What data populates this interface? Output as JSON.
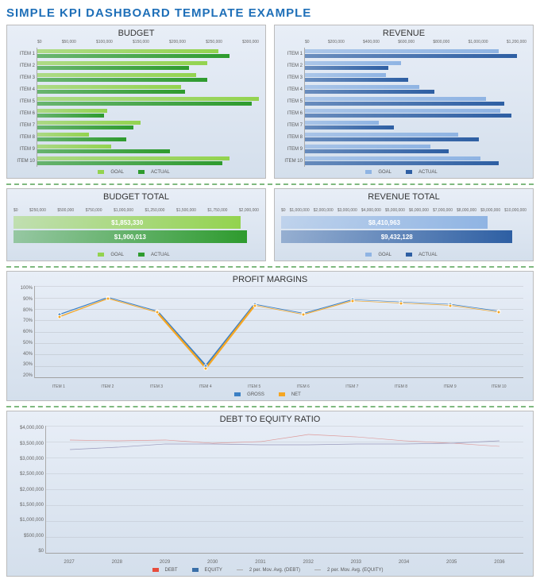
{
  "page_title": "SIMPLE KPI DASHBOARD TEMPLATE EXAMPLE",
  "legends": {
    "goal": "GOAL",
    "actual": "ACTUAL",
    "gross": "GROSS",
    "net": "NET",
    "debt": "DEBT",
    "equity": "EQUITY",
    "mov_debt": "2 per. Mov. Avg. (DEBT)",
    "mov_equity": "2 per. Mov. Avg. (EQUITY)"
  },
  "budget": {
    "title": "BUDGET",
    "ticks": [
      "$0",
      "$50,000",
      "$100,000",
      "$150,000",
      "$200,000",
      "$250,000",
      "$300,000"
    ],
    "max": 300000,
    "items": [
      "ITEM 1",
      "ITEM 2",
      "ITEM 3",
      "ITEM 4",
      "ITEM 5",
      "ITEM 6",
      "ITEM 7",
      "ITEM 8",
      "ITEM 9",
      "ITEM 10"
    ]
  },
  "revenue": {
    "title": "REVENUE",
    "ticks": [
      "$0",
      "$200,000",
      "$400,000",
      "$600,000",
      "$800,000",
      "$1,000,000",
      "$1,200,000"
    ],
    "max": 1200000,
    "items": [
      "ITEM 1",
      "ITEM 2",
      "ITEM 3",
      "ITEM 4",
      "ITEM 5",
      "ITEM 6",
      "ITEM 7",
      "ITEM 8",
      "ITEM 9",
      "ITEM 10"
    ]
  },
  "budget_total": {
    "title": "BUDGET TOTAL",
    "ticks": [
      "$0",
      "$250,000",
      "$500,000",
      "$750,000",
      "$1,000,000",
      "$1,250,000",
      "$1,500,000",
      "$1,750,000",
      "$2,000,000"
    ],
    "max": 2000000,
    "goal_label": "$1,853,330",
    "actual_label": "$1,900,013"
  },
  "revenue_total": {
    "title": "REVENUE TOTAL",
    "ticks": [
      "$0",
      "$1,000,000",
      "$2,000,000",
      "$3,000,000",
      "$4,000,000",
      "$5,000,000",
      "$6,000,000",
      "$7,000,000",
      "$8,000,000",
      "$9,000,000",
      "$10,000,000"
    ],
    "max": 10000000,
    "goal_label": "$8,410,963",
    "actual_label": "$9,432,128"
  },
  "profit": {
    "title": "PROFIT MARGINS",
    "yticks": [
      "100%",
      "90%",
      "80%",
      "70%",
      "60%",
      "50%",
      "40%",
      "30%",
      "20%"
    ],
    "items": [
      "ITEM 1",
      "ITEM 2",
      "ITEM 3",
      "ITEM 4",
      "ITEM 5",
      "ITEM 6",
      "ITEM 7",
      "ITEM 8",
      "ITEM 9",
      "ITEM 10"
    ]
  },
  "debt_equity": {
    "title": "DEBT TO EQUITY RATIO",
    "yticks": [
      "$4,000,000",
      "$3,500,000",
      "$3,000,000",
      "$2,500,000",
      "$2,000,000",
      "$1,500,000",
      "$1,000,000",
      "$500,000",
      "$0"
    ],
    "max": 4000000,
    "years": [
      "2027",
      "2028",
      "2029",
      "2030",
      "2031",
      "2032",
      "2033",
      "2034",
      "2035",
      "2036"
    ]
  },
  "chart_data": [
    {
      "type": "bar",
      "orientation": "horizontal",
      "title": "BUDGET",
      "xlabel": "",
      "ylabel": "",
      "xlim": [
        0,
        300000
      ],
      "categories": [
        "ITEM 1",
        "ITEM 2",
        "ITEM 3",
        "ITEM 4",
        "ITEM 5",
        "ITEM 6",
        "ITEM 7",
        "ITEM 8",
        "ITEM 9",
        "ITEM 10"
      ],
      "series": [
        {
          "name": "GOAL",
          "values": [
            245000,
            230000,
            215000,
            195000,
            300000,
            95000,
            140000,
            70000,
            100000,
            260000
          ]
        },
        {
          "name": "ACTUAL",
          "values": [
            260000,
            205000,
            230000,
            200000,
            290000,
            90000,
            130000,
            120000,
            180000,
            250000
          ]
        }
      ]
    },
    {
      "type": "bar",
      "orientation": "horizontal",
      "title": "REVENUE",
      "xlabel": "",
      "ylabel": "",
      "xlim": [
        0,
        1200000
      ],
      "categories": [
        "ITEM 1",
        "ITEM 2",
        "ITEM 3",
        "ITEM 4",
        "ITEM 5",
        "ITEM 6",
        "ITEM 7",
        "ITEM 8",
        "ITEM 9",
        "ITEM 10"
      ],
      "series": [
        {
          "name": "GOAL",
          "values": [
            1050000,
            520000,
            440000,
            620000,
            980000,
            1060000,
            400000,
            830000,
            680000,
            950000
          ]
        },
        {
          "name": "ACTUAL",
          "values": [
            1150000,
            450000,
            560000,
            700000,
            1080000,
            1120000,
            480000,
            940000,
            780000,
            1050000
          ]
        }
      ]
    },
    {
      "type": "bar",
      "orientation": "horizontal",
      "title": "BUDGET TOTAL",
      "xlim": [
        0,
        2000000
      ],
      "categories": [
        "GOAL",
        "ACTUAL"
      ],
      "values": [
        1853330,
        1900013
      ]
    },
    {
      "type": "bar",
      "orientation": "horizontal",
      "title": "REVENUE TOTAL",
      "xlim": [
        0,
        10000000
      ],
      "categories": [
        "GOAL",
        "ACTUAL"
      ],
      "values": [
        8410963,
        9432128
      ]
    },
    {
      "type": "line",
      "title": "PROFIT MARGINS",
      "ylabel": "%",
      "ylim": [
        20,
        100
      ],
      "categories": [
        "ITEM 1",
        "ITEM 2",
        "ITEM 3",
        "ITEM 4",
        "ITEM 5",
        "ITEM 6",
        "ITEM 7",
        "ITEM 8",
        "ITEM 9",
        "ITEM 10"
      ],
      "series": [
        {
          "name": "GROSS",
          "values": [
            75,
            90,
            78,
            30,
            84,
            76,
            88,
            86,
            84,
            78
          ]
        },
        {
          "name": "NET",
          "values": [
            73,
            89,
            77,
            28,
            83,
            75,
            87,
            85,
            83,
            77
          ]
        }
      ]
    },
    {
      "type": "bar",
      "title": "DEBT TO EQUITY RATIO",
      "ylim": [
        0,
        4000000
      ],
      "categories": [
        "2027",
        "2028",
        "2029",
        "2030",
        "2031",
        "2032",
        "2033",
        "2034",
        "2035",
        "2036"
      ],
      "series": [
        {
          "name": "DEBT",
          "values": [
            3550000,
            3500000,
            3600000,
            3300000,
            3700000,
            3750000,
            3550000,
            3500000,
            3400000,
            3300000
          ]
        },
        {
          "name": "EQUITY",
          "values": [
            3250000,
            3400000,
            3450000,
            3400000,
            3400000,
            3400000,
            3450000,
            3400000,
            3500000,
            3550000
          ]
        }
      ]
    }
  ]
}
